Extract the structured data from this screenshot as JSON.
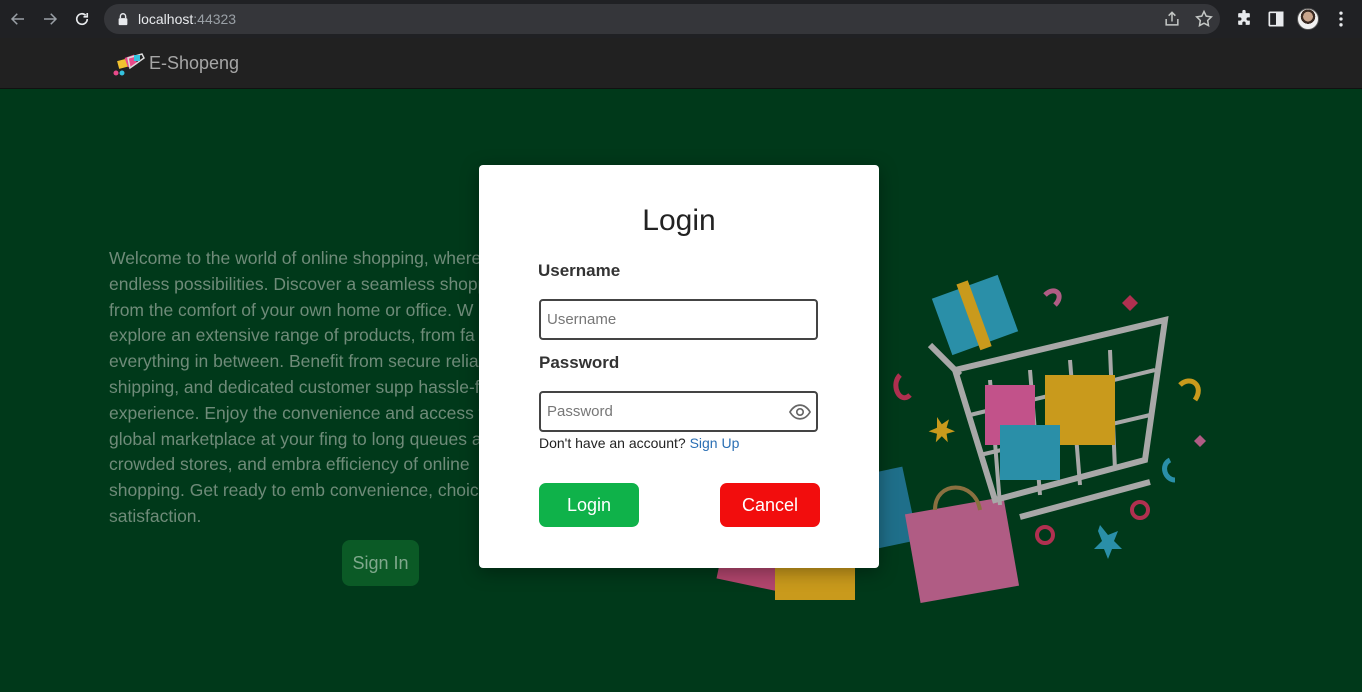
{
  "browser": {
    "url_host": "localhost",
    "url_port": ":44323"
  },
  "header": {
    "brand": "E-Shopeng"
  },
  "main": {
    "welcome_text": "Welcome to the world of online shopping, where endless possibilities. Discover a seamless shopping from the comfort of your own home or office. W explore an extensive range of products, from fa and everything in between. Benefit from secure reliable shipping, and dedicated customer supp hassle-free experience. Enjoy the convenience and access to a global marketplace at your fing to long queues and crowded stores, and embra efficiency of online shopping. Get ready to emb convenience, choice, and satisfaction.",
    "signin_label": "Sign In"
  },
  "modal": {
    "title": "Login",
    "username_label": "Username",
    "username_placeholder": "Username",
    "username_value": "",
    "password_label": "Password",
    "password_placeholder": "Password",
    "password_value": "",
    "signup_prompt": "Don't have an account?",
    "signup_link": "Sign Up",
    "login_button": "Login",
    "cancel_button": "Cancel"
  },
  "colors": {
    "page_bg": "#00391a",
    "header_bg": "#212121",
    "login_green": "#0fb24a",
    "cancel_red": "#f20d0d",
    "link_blue": "#2a6fb4"
  },
  "icons": [
    "back-arrow-icon",
    "forward-arrow-icon",
    "reload-icon",
    "lock-icon",
    "share-icon",
    "star-icon",
    "extensions-icon",
    "side-panel-icon",
    "menu-dots-icon",
    "eye-icon"
  ]
}
